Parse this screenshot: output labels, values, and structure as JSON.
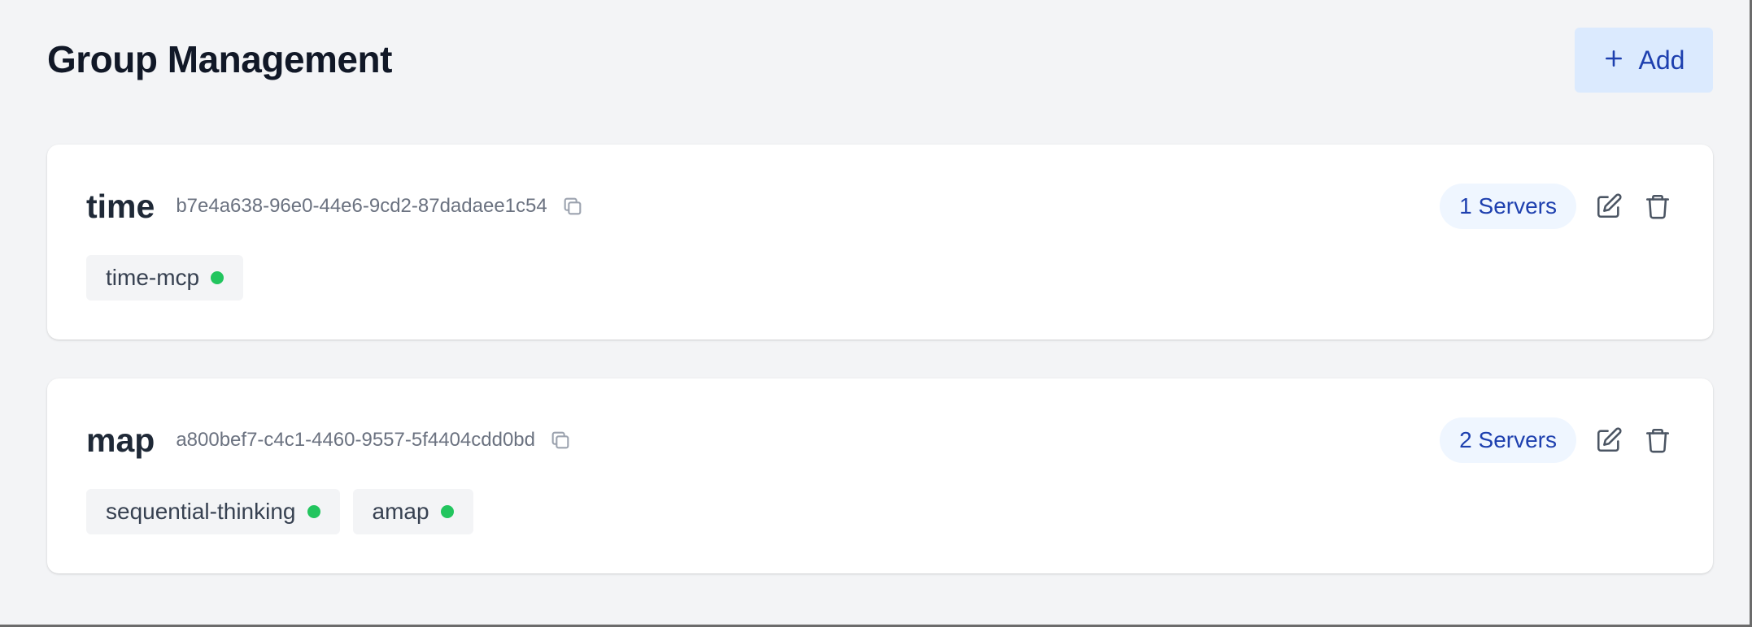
{
  "header": {
    "title": "Group Management",
    "add_label": "Add"
  },
  "colors": {
    "accent": "#1e40af",
    "accent_bg": "#dbeafe",
    "status_online": "#22c55e"
  },
  "groups": [
    {
      "name": "time",
      "id": "b7e4a638-96e0-44e6-9cd2-87dadaee1c54",
      "servers_badge": "1 Servers",
      "servers": [
        {
          "name": "time-mcp",
          "status": "online"
        }
      ]
    },
    {
      "name": "map",
      "id": "a800bef7-c4c1-4460-9557-5f4404cdd0bd",
      "servers_badge": "2 Servers",
      "servers": [
        {
          "name": "sequential-thinking",
          "status": "online"
        },
        {
          "name": "amap",
          "status": "online"
        }
      ]
    }
  ]
}
